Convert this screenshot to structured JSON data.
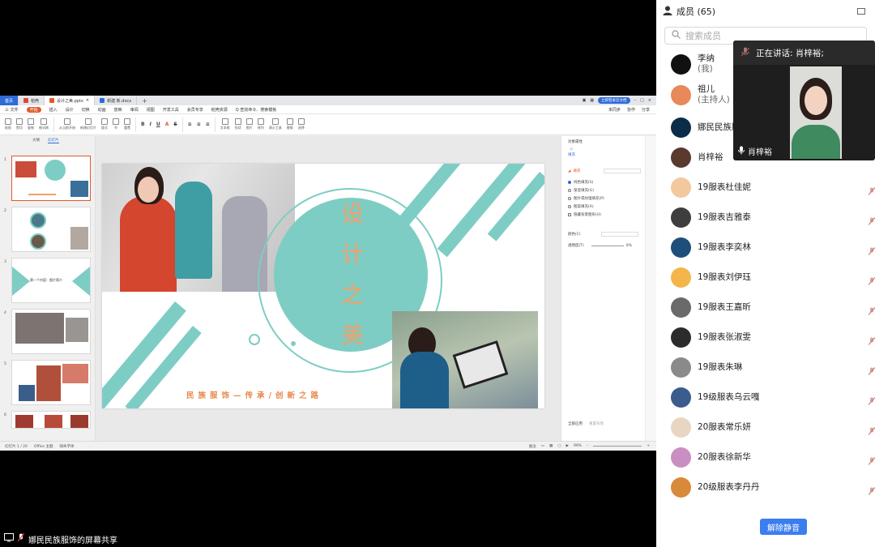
{
  "wps": {
    "tabs": [
      {
        "label": "首页"
      },
      {
        "label": "稻壳"
      },
      {
        "label": "设计之美.pptx"
      },
      {
        "label": "新建 新.docx"
      }
    ],
    "login": "立即登录云文档",
    "menu": [
      "三 文件",
      "开始",
      "插入",
      "设计",
      "切换",
      "动画",
      "放映",
      "审阅",
      "视图",
      "开发工具",
      "会员专享",
      "稻壳资源",
      "Q 查找命令、搜索模板"
    ],
    "menu_right": [
      "未同步",
      "协作",
      "分享"
    ],
    "ribbon": [
      "粘贴",
      "剪切",
      "复制",
      "格式刷",
      "从当前开始",
      "新建幻灯片",
      "版式",
      "节",
      "重置",
      "文本框",
      "形状",
      "图片",
      "排列",
      "演示工具",
      "替换",
      "选择"
    ],
    "thumb_tabs": [
      "大纲",
      "幻灯片"
    ],
    "thumb_nums": [
      "1",
      "2",
      "3",
      "4",
      "5",
      "6"
    ],
    "thumb3_text": "第一个内容：图片简介",
    "slide": {
      "title_chars": [
        "设",
        "计",
        "之",
        "美"
      ],
      "subtitle": "民族服饰—传承/创新之路"
    },
    "props": {
      "header": "对象属性",
      "tab": "填充",
      "section": "填充",
      "options": [
        "纯色填充(S)",
        "渐变填充(G)",
        "图片或纹理填充(P)",
        "图案填充(A)",
        "隐藏背景图形(H)"
      ],
      "color_label": "颜色(C)",
      "transparency_label": "透明度(T)",
      "transparency_value": "0%",
      "bottom": [
        "全部应用",
        "重置背景"
      ]
    },
    "status": {
      "slide_info": "幻灯片 1 / 20",
      "theme": "Office 主题",
      "font_missing": "缺失字体",
      "notes": "备注",
      "zoom": "99%"
    }
  },
  "share_bar": "娜民民族服饰的屏幕共享",
  "panel": {
    "title": "成员 (65)",
    "search_placeholder": "搜索成员",
    "members": [
      {
        "name": "李纳",
        "sub": "(我)",
        "avatar_color": "#111111"
      },
      {
        "name": "祖儿",
        "sub": "(主持人)",
        "avatar_color": "#e7895a"
      },
      {
        "name": "娜民民族服饰",
        "sub": "",
        "avatar_color": "#0b2d4a"
      },
      {
        "name": "肖梓裕",
        "sub": "",
        "avatar_color": "#5b3a2e"
      },
      {
        "name": "19服表杜佳妮",
        "sub": "",
        "avatar_color": "#f2c89e"
      },
      {
        "name": "19服表吉雅泰",
        "sub": "",
        "avatar_color": "#3e3e3e"
      },
      {
        "name": "19服表李奕林",
        "sub": "",
        "avatar_color": "#1e4f7a"
      },
      {
        "name": "19服表刘伊珏",
        "sub": "",
        "avatar_color": "#f4b64a"
      },
      {
        "name": "19服表王嘉昕",
        "sub": "",
        "avatar_color": "#6a6a6a"
      },
      {
        "name": "19服表张淑雯",
        "sub": "",
        "avatar_color": "#2c2c2c"
      },
      {
        "name": "19服表朱琳",
        "sub": "",
        "avatar_color": "#8a8a8a"
      },
      {
        "name": "19级服表乌云嘎",
        "sub": "",
        "avatar_color": "#3b5c8c"
      },
      {
        "name": "20服表常乐妍",
        "sub": "",
        "avatar_color": "#e9d6c2"
      },
      {
        "name": "20服表徐新华",
        "sub": "",
        "avatar_color": "#c98fc0"
      },
      {
        "name": "20级服表李丹丹",
        "sub": "",
        "avatar_color": "#d88a3a"
      }
    ],
    "unmute": "解除静音"
  },
  "speaker": {
    "label": "正在讲话: 肖梓裕;",
    "name": "肖梓裕"
  },
  "colors": {
    "teal": "#7ecdc4",
    "title_orange": "#f2a067",
    "accent_orange": "#e05a2a",
    "wps_blue": "#2f6bd8",
    "unmute_blue": "#3b7ef0"
  }
}
